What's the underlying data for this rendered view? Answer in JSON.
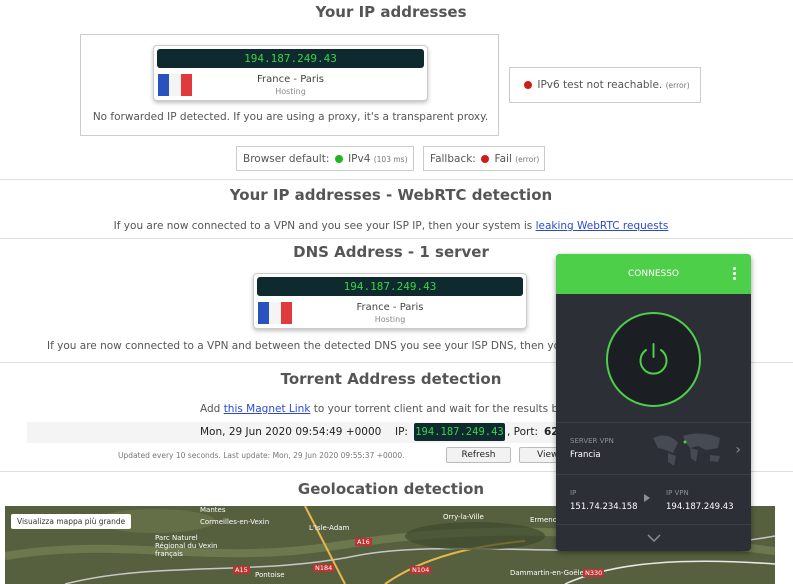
{
  "ip_section": {
    "title": "Your IP addresses",
    "ip": "194.187.249.43",
    "location": "France - Paris",
    "type": "Hosting",
    "forwarded_note": "No forwarded IP detected. If you are using a proxy, it's a transparent proxy.",
    "ipv6": {
      "text": "IPv6 test not reachable.",
      "status": "(error)"
    },
    "browser_default": {
      "label": "Browser default:",
      "protocol": "IPv4",
      "time": "(103 ms)"
    },
    "fallback": {
      "label": "Fallback:",
      "value": "Fail",
      "status": "(error)"
    }
  },
  "webrtc": {
    "title": "Your IP addresses - WebRTC detection",
    "text": "If you are now connected to a VPN and you see your ISP IP, then your system is",
    "link": "leaking WebRTC requests"
  },
  "dns": {
    "title": "DNS Address - 1 server",
    "ip": "194.187.249.43",
    "location": "France - Paris",
    "type": "Hosting",
    "note": "If you are now connected to a VPN and between the detected DNS you see your ISP DNS, then yo"
  },
  "torrent": {
    "title": "Torrent Address detection",
    "text_before": "Add",
    "link": "this Magnet Link",
    "text_after": "to your torrent client and wait for the results be",
    "datetime": "Mon, 29 Jun 2020 09:54:49 +0000",
    "ip_label": "IP:",
    "ip": "194.187.249.43",
    "port_label": ", Port:",
    "port": "62",
    "updated": "Updated every 10 seconds. Last update: Mon, 29 Jun 2020 09:55:37 +0000.",
    "refresh": "Refresh",
    "view": "View"
  },
  "geo": {
    "title": "Geolocation detection",
    "map_button": "Visualizza mappa più grande",
    "map_labels": [
      "Mantes",
      "Cormeilles-en-Vexin",
      "L'Isle-Adam",
      "Orry-la-Ville",
      "Ermenonville",
      "Parc Naturel Régional du Vexin français",
      "Pontoise",
      "Dammartin-en-Goële",
      "A15",
      "N184",
      "A16",
      "N104",
      "N330"
    ]
  },
  "vpn": {
    "status": "CONNESSO",
    "server_label": "SERVER VPN",
    "server": "Francia",
    "ip_label": "IP",
    "ip": "151.74.234.158",
    "vpn_ip_label": "IP VPN",
    "vpn_ip": "194.187.249.43"
  },
  "colors": {
    "accent_green": "#4ecf4a",
    "ip_text": "#39d24a",
    "link": "#2a4bd1",
    "error_red": "#d21a1a"
  }
}
